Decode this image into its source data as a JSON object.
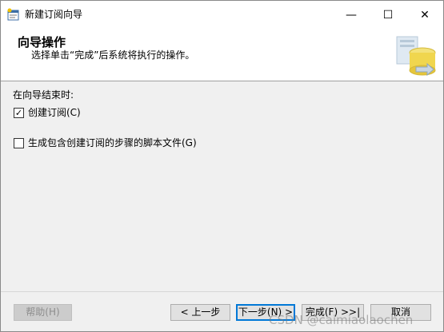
{
  "window": {
    "title": "新建订阅向导",
    "controls": {
      "minimize": "—",
      "maximize": "☐",
      "close": "✕"
    }
  },
  "header": {
    "title": "向导操作",
    "description": "选择单击“完成”后系统将执行的操作。"
  },
  "options": {
    "section_label": "在向导结束时:",
    "items": [
      {
        "label": "创建订阅(C)",
        "checked": true,
        "mark": "✓"
      },
      {
        "label": "生成包含创建订阅的步骤的脚本文件(G)",
        "checked": false,
        "mark": ""
      }
    ]
  },
  "buttons": {
    "help": "帮助(H)",
    "back": "< 上一步",
    "next": "下一步(N) >",
    "finish": "完成(F) >>|",
    "cancel": "取消"
  },
  "watermark": "CSDN @caimiaolaochen",
  "colors": {
    "accent": "#0078d7",
    "header_bg": "#ffffff",
    "body_bg": "#f0f0f0"
  },
  "icons": {
    "app": "wizard-app-icon",
    "header": "database-wizard-graphic"
  }
}
